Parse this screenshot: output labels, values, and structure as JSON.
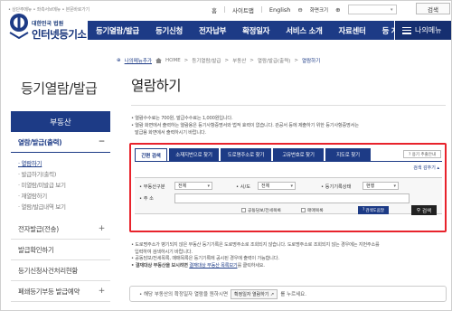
{
  "topbar": {
    "quick_links": "• 상단주메뉴 • 좌측서브메뉴 • 본문바로가기",
    "home": "홈",
    "sitemap": "사이트맵",
    "english": "English",
    "zoom_label": "화면크기",
    "search_label": "검색"
  },
  "logo": {
    "sub": "대한민국 법원",
    "main": "인터넷등기소"
  },
  "nav": {
    "items": [
      "등기열람/발급",
      "등기신청",
      "전자납부",
      "확정일자",
      "서비스 소개",
      "자료센터",
      "등 계"
    ],
    "menu_label": "나의메뉴"
  },
  "sidebar": {
    "title": "등기열람/발급",
    "section": "부동산",
    "active": "열람/발급(출력)",
    "subs": [
      "· 열람하기",
      "· 발급하기(출력)",
      "· 미열람/미발급 보기",
      "· 재열람하기",
      "· 열람/발급내역 보기"
    ],
    "rows": [
      "전자발급(전송)",
      "발급확인하기",
      "등기신청사건처리현황",
      "폐쇄등기부등 발급예약"
    ]
  },
  "breadcrumb": {
    "mymenu": "나의메뉴추가",
    "path": [
      "HOME",
      "등기열람/발급",
      "부동산",
      "열람/발급(출력)"
    ],
    "current": "열람하기"
  },
  "page": {
    "title": "열람하기"
  },
  "notes": {
    "line1": "• 열람수수료는 700원, 발급수수료는 1,000원입니다.",
    "line2": "• 열람 화면에서 출력하는 열람용은 등기사항증명서와 법적 효력이 없습니다. 관공서 등에 제출하기 위한 등기사항증명서는",
    "line3": "발급용 화면에서 출력하시기 바랍니다."
  },
  "search": {
    "tabs": [
      "간편 검색",
      "소재지번으로 찾기",
      "도로명주소로 찾기",
      "고유번호로 찾기",
      "지도로 찾기"
    ],
    "help": "? 용기 추출안내",
    "hide": "검색 감추기",
    "type_label": "• 부동산구분",
    "type_value": "전체",
    "city_label": "• 시/도",
    "city_value": "전체",
    "status_label": "• 등기기록상태",
    "status_value": "현행",
    "addr_label": "• 주 소",
    "addr_value": "",
    "check1": "공동담보/전세목록",
    "check2": "매매목록",
    "adv_label": "검색도움말",
    "submit_label": "검색"
  },
  "notes2": {
    "line1": "• 도로명주소가 병기되지 않은 부동산 등기기록은 도로명주소로 조회되지 않습니다. 도로명주소로 조회되지 않는 경우에는 지번주소를",
    "line2": "입력하여 검색하시기 바랍니다.",
    "line3": "• 공동담보/전세목록, 매매목록은 등기기록에 공시된 경우에 출력이 가능합니다.",
    "line4_pre": "• 결재대상 부동산을 보시려면",
    "line4_link": "결재대상 부동산 목록보기",
    "line4_post": "를 클릭하세요."
  },
  "info": {
    "pre": "• 해당 부동산의 확정일자 열람을 원하시면",
    "button": "확정일자 열람하기 ↗",
    "post": "를 누르세요."
  }
}
